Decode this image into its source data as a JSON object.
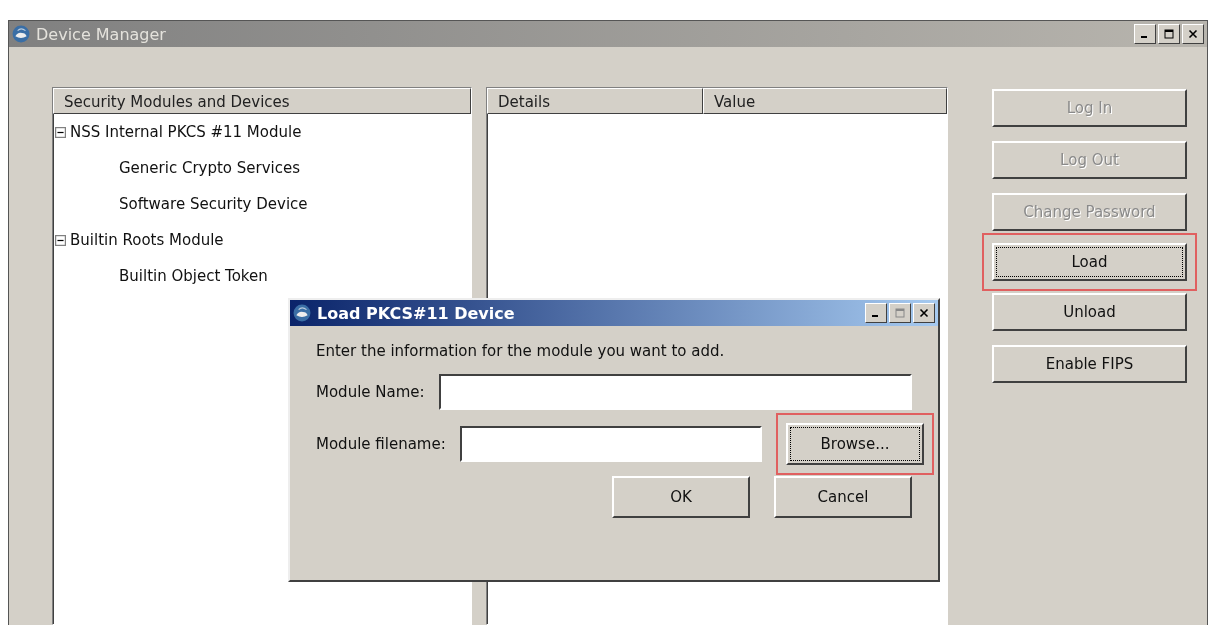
{
  "window": {
    "title": "Device Manager",
    "active": false
  },
  "tree": {
    "header": "Security Modules and Devices",
    "items": [
      {
        "label": "NSS Internal PKCS #11 Module",
        "expanded": true,
        "children": [
          {
            "label": "Generic Crypto Services"
          },
          {
            "label": "Software Security Device"
          }
        ]
      },
      {
        "label": "Builtin Roots Module",
        "expanded": true,
        "children": [
          {
            "label": "Builtin Object Token"
          }
        ]
      }
    ]
  },
  "details": {
    "columns": [
      "Details",
      "Value"
    ]
  },
  "buttons": [
    {
      "label": "Log In",
      "disabled": true,
      "highlighted": false,
      "focused": false
    },
    {
      "label": "Log Out",
      "disabled": true,
      "highlighted": false,
      "focused": false
    },
    {
      "label": "Change Password",
      "disabled": true,
      "highlighted": false,
      "focused": false
    },
    {
      "label": "Load",
      "disabled": false,
      "highlighted": true,
      "focused": true
    },
    {
      "label": "Unload",
      "disabled": false,
      "highlighted": false,
      "focused": false
    },
    {
      "label": "Enable FIPS",
      "disabled": false,
      "highlighted": false,
      "focused": false
    }
  ],
  "dialog": {
    "title": "Load PKCS#11 Device",
    "active": true,
    "prompt": "Enter the information for the module you want to add.",
    "fields": [
      {
        "label": "Module Name:"
      },
      {
        "label": "Module filename:",
        "button": {
          "label": "Browse...",
          "highlighted": true,
          "focused": true
        }
      }
    ],
    "buttons": [
      {
        "label": "OK"
      },
      {
        "label": "Cancel"
      }
    ]
  }
}
